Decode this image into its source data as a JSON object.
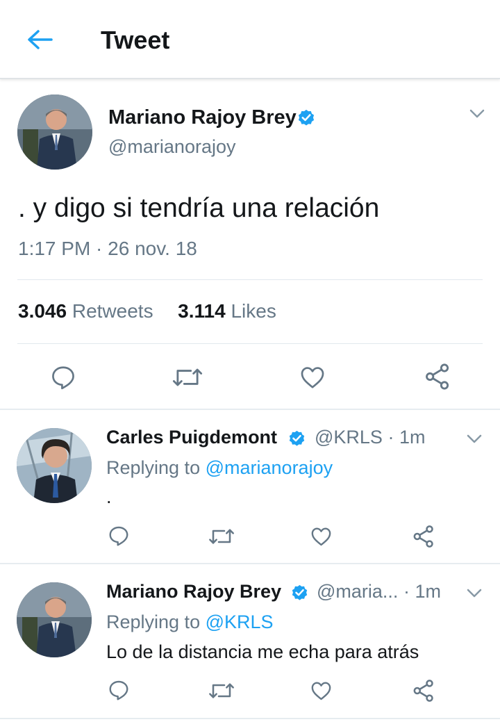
{
  "header": {
    "title": "Tweet",
    "back_icon": "arrow-left-icon"
  },
  "colors": {
    "accent": "#1da1f2",
    "muted": "#657786",
    "text": "#14171a",
    "divider": "#e1e8ed"
  },
  "tweet": {
    "author_name": "Mariano Rajoy Brey",
    "handle": "@marianorajoy",
    "text": ". y digo si tendría una relación",
    "timestamp": "1:17 PM · 26 nov. 18",
    "retweets_count": "3.046",
    "retweets_label": "Retweets",
    "likes_count": "3.114",
    "likes_label": "Likes",
    "actions": [
      "reply-icon",
      "retweet-icon",
      "like-icon",
      "share-icon"
    ]
  },
  "replies": [
    {
      "author_name": "Carles Puigdemont",
      "handle": "@KRLS",
      "time": "· 1m",
      "replying_prefix": "Replying to",
      "replying_to": "@marianorajoy",
      "text": "."
    },
    {
      "author_name": "Mariano Rajoy Brey",
      "handle": "@maria...",
      "time": "· 1m",
      "replying_prefix": "Replying to",
      "replying_to": "@KRLS",
      "text": "Lo de la distancia me echa para atrás"
    }
  ]
}
